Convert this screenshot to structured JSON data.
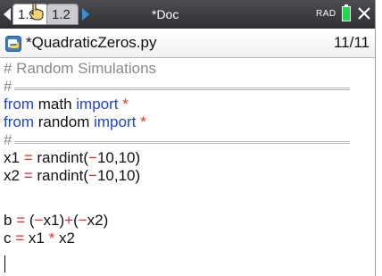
{
  "topbar": {
    "tabs": [
      {
        "label": "1.1"
      },
      {
        "label": "1.2"
      }
    ],
    "doc_title": "*Doc",
    "angle_mode": "RAD",
    "battery_color": "#1fd84b"
  },
  "file": {
    "name": "*QuadraticZeros.py",
    "line_counter": "11/11",
    "icon": "python-file-icon"
  },
  "code": {
    "line1": "# Random Simulations",
    "rule_hash": "#",
    "kw_from": "from",
    "kw_import": "import",
    "mod_math": "math",
    "mod_random": "random",
    "star": "*",
    "line6_var": "x1",
    "line7_var": "x2",
    "eq": "=",
    "randint": "randint",
    "paren_open": "(",
    "paren_close": ")",
    "minus": "−",
    "args": "10,10",
    "b_var": "b",
    "c_var": "c",
    "x1": "x1",
    "x2": "x2",
    "plus": "+"
  },
  "colors": {
    "keyword": "#1f43d9",
    "operator": "#e0322d",
    "comment": "#8a8a8a"
  }
}
